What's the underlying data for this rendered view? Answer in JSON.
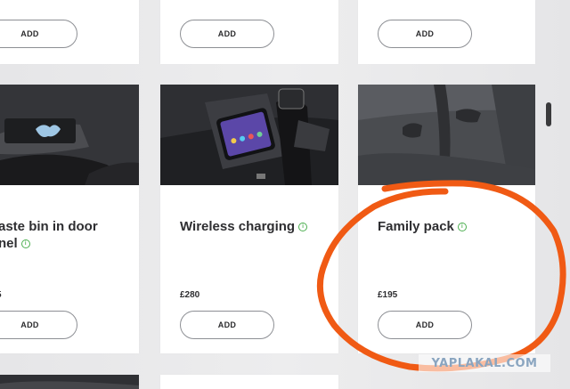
{
  "products": {
    "top_row": [
      {
        "add_label": "ADD"
      },
      {
        "add_label": "ADD"
      },
      {
        "add_label": "ADD"
      }
    ],
    "items": [
      {
        "title_line1": "aste bin in door",
        "title_line2": "nel",
        "price": "5",
        "add_label": "ADD",
        "info_icon": "i"
      },
      {
        "title_line1": "Wireless charging",
        "price": "£280",
        "add_label": "ADD",
        "info_icon": "i"
      },
      {
        "title_line1": "Family pack",
        "price": "£195",
        "add_label": "ADD",
        "info_icon": "i"
      }
    ]
  },
  "annotation": {
    "color": "#f05a14"
  },
  "watermark": {
    "text": "YAPLAKAL.COM"
  },
  "colors": {
    "info_accent": "#4caf50",
    "card_background": "#ffffff",
    "page_background": "#e9e9ea"
  }
}
